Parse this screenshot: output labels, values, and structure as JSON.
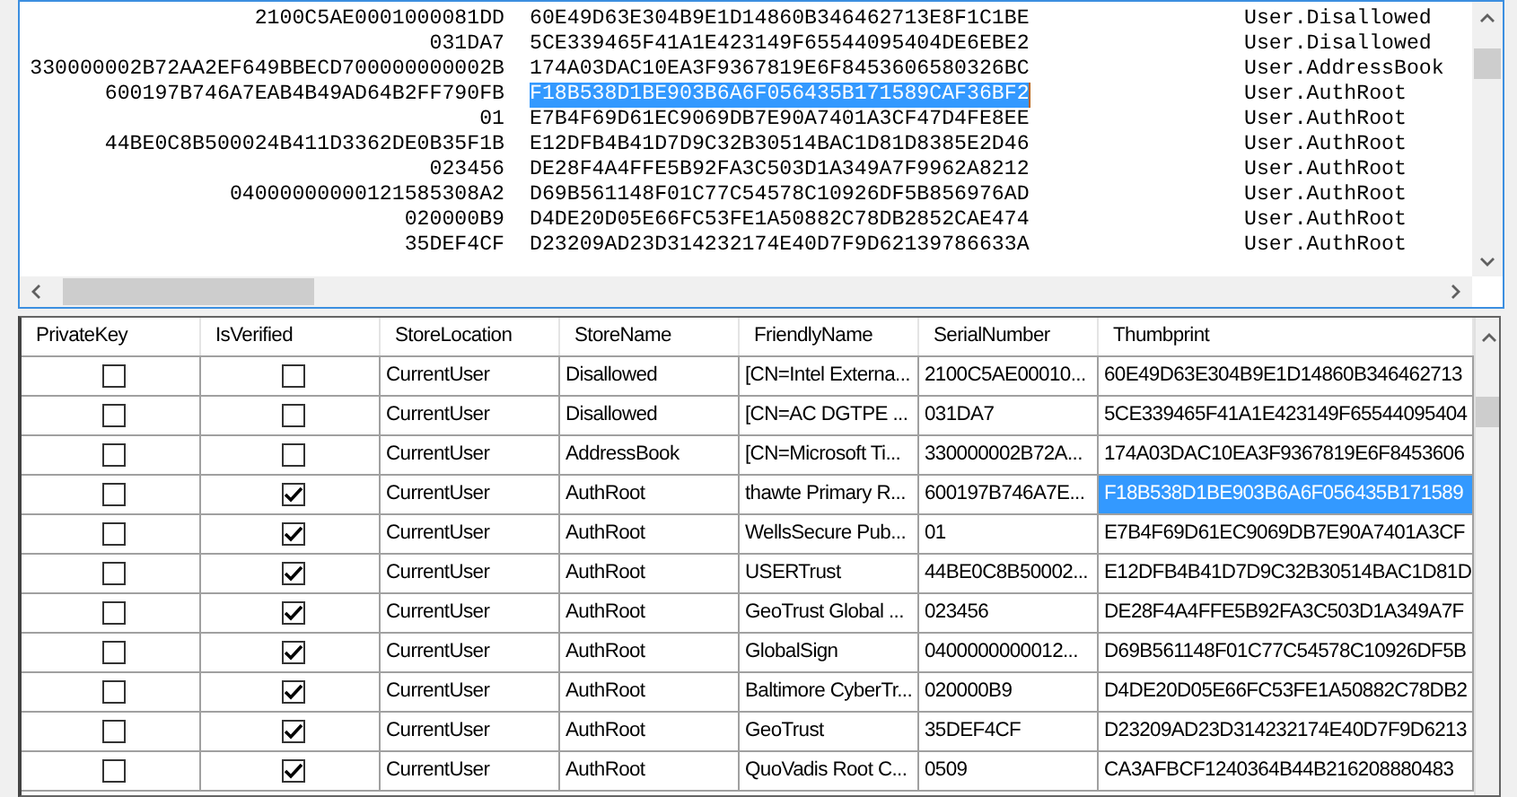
{
  "text_panel": {
    "lines": [
      {
        "serial": "2100C5AE0001000081DD",
        "thumbprint": "60E49D63E304B9E1D14860B346462713E8F1C1BE",
        "store": "User.Disallowed",
        "selected": false
      },
      {
        "serial": "031DA7",
        "thumbprint": "5CE339465F41A1E423149F65544095404DE6EBE2",
        "store": "User.Disallowed",
        "selected": false
      },
      {
        "serial": "330000002B72AA2EF649BBECD700000000002B",
        "thumbprint": "174A03DAC10EA3F9367819E6F8453606580326BC",
        "store": "User.AddressBook",
        "selected": false
      },
      {
        "serial": "600197B746A7EAB4B49AD64B2FF790FB",
        "thumbprint": "F18B538D1BE903B6A6F056435B171589CAF36BF2",
        "store": "User.AuthRoot",
        "selected": true
      },
      {
        "serial": "01",
        "thumbprint": "E7B4F69D61EC9069DB7E90A7401A3CF47D4FE8EE",
        "store": "User.AuthRoot",
        "selected": false
      },
      {
        "serial": "44BE0C8B500024B411D3362DE0B35F1B",
        "thumbprint": "E12DFB4B41D7D9C32B30514BAC1D81D8385E2D46",
        "store": "User.AuthRoot",
        "selected": false
      },
      {
        "serial": "023456",
        "thumbprint": "DE28F4A4FFE5B92FA3C503D1A349A7F9962A8212",
        "store": "User.AuthRoot",
        "selected": false
      },
      {
        "serial": "04000000000121585308A2",
        "thumbprint": "D69B561148F01C77C54578C10926DF5B856976AD",
        "store": "User.AuthRoot",
        "selected": false
      },
      {
        "serial": "020000B9",
        "thumbprint": "D4DE20D05E66FC53FE1A50882C78DB2852CAE474",
        "store": "User.AuthRoot",
        "selected": false
      },
      {
        "serial": "35DEF4CF",
        "thumbprint": "D23209AD23D314232174E40D7F9D62139786633A",
        "store": "User.AuthRoot",
        "selected": false
      }
    ]
  },
  "grid": {
    "columns": [
      "PrivateKey",
      "IsVerified",
      "StoreLocation",
      "StoreName",
      "FriendlyName",
      "SerialNumber",
      "Thumbprint"
    ],
    "rows": [
      {
        "private_key": false,
        "is_verified": false,
        "store_location": "CurrentUser",
        "store_name": "Disallowed",
        "friendly_name": "[CN=Intel Externa...",
        "serial_number": "2100C5AE00010...",
        "thumbprint": "60E49D63E304B9E1D14860B346462713",
        "selected": false
      },
      {
        "private_key": false,
        "is_verified": false,
        "store_location": "CurrentUser",
        "store_name": "Disallowed",
        "friendly_name": "[CN=AC DGTPE ...",
        "serial_number": "031DA7",
        "thumbprint": "5CE339465F41A1E423149F65544095404",
        "selected": false
      },
      {
        "private_key": false,
        "is_verified": false,
        "store_location": "CurrentUser",
        "store_name": "AddressBook",
        "friendly_name": "[CN=Microsoft Ti...",
        "serial_number": "330000002B72A...",
        "thumbprint": "174A03DAC10EA3F9367819E6F8453606",
        "selected": false
      },
      {
        "private_key": false,
        "is_verified": true,
        "store_location": "CurrentUser",
        "store_name": "AuthRoot",
        "friendly_name": "thawte Primary R...",
        "serial_number": "600197B746A7E...",
        "thumbprint": "F18B538D1BE903B6A6F056435B171589",
        "selected": true
      },
      {
        "private_key": false,
        "is_verified": true,
        "store_location": "CurrentUser",
        "store_name": "AuthRoot",
        "friendly_name": "WellsSecure Pub...",
        "serial_number": "01",
        "thumbprint": "E7B4F69D61EC9069DB7E90A7401A3CF",
        "selected": false
      },
      {
        "private_key": false,
        "is_verified": true,
        "store_location": "CurrentUser",
        "store_name": "AuthRoot",
        "friendly_name": "USERTrust",
        "serial_number": "44BE0C8B50002...",
        "thumbprint": "E12DFB4B41D7D9C32B30514BAC1D81D",
        "selected": false
      },
      {
        "private_key": false,
        "is_verified": true,
        "store_location": "CurrentUser",
        "store_name": "AuthRoot",
        "friendly_name": "GeoTrust Global ...",
        "serial_number": "023456",
        "thumbprint": "DE28F4A4FFE5B92FA3C503D1A349A7F",
        "selected": false
      },
      {
        "private_key": false,
        "is_verified": true,
        "store_location": "CurrentUser",
        "store_name": "AuthRoot",
        "friendly_name": "GlobalSign",
        "serial_number": "0400000000012...",
        "thumbprint": "D69B561148F01C77C54578C10926DF5B",
        "selected": false
      },
      {
        "private_key": false,
        "is_verified": true,
        "store_location": "CurrentUser",
        "store_name": "AuthRoot",
        "friendly_name": "Baltimore CyberTr...",
        "serial_number": "020000B9",
        "thumbprint": "D4DE20D05E66FC53FE1A50882C78DB2",
        "selected": false
      },
      {
        "private_key": false,
        "is_verified": true,
        "store_location": "CurrentUser",
        "store_name": "AuthRoot",
        "friendly_name": "GeoTrust",
        "serial_number": "35DEF4CF",
        "thumbprint": "D23209AD23D314232174E40D7F9D6213",
        "selected": false
      },
      {
        "private_key": false,
        "is_verified": true,
        "store_location": "CurrentUser",
        "store_name": "AuthRoot",
        "friendly_name": "QuoVadis Root C...",
        "serial_number": "0509",
        "thumbprint": "CA3AFBCF1240364B44B216208880483",
        "selected": false
      }
    ]
  }
}
